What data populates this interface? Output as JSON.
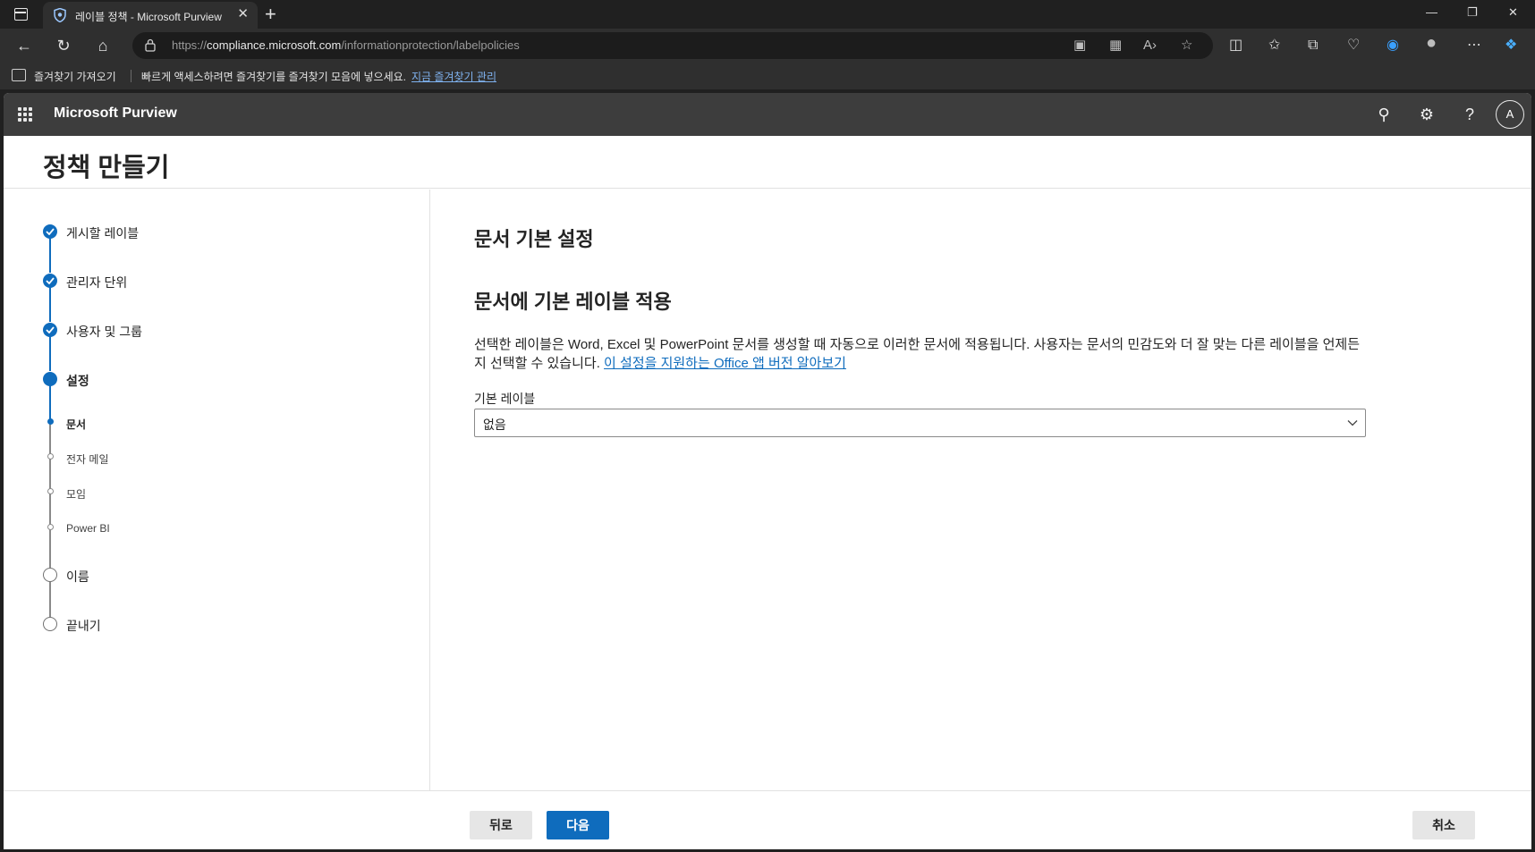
{
  "browser": {
    "tab_title": "레이블 정책 - Microsoft Purview",
    "tab_close": "✕",
    "new_tab": "+",
    "url_prefix": "https://",
    "url_host": "compliance.microsoft.com",
    "url_path": "/informationprotection/labelpolicies",
    "favorites": {
      "import_label": "즐겨찾기 가져오기",
      "message": "빠르게 액세스하려면 즐겨찾기를 즐겨찾기 모음에 넣으세요.",
      "manage_link": "지금 즐겨찾기 관리"
    },
    "window_controls": {
      "minimize": "—",
      "restore": "❐",
      "close": "✕"
    }
  },
  "app": {
    "brand": "Microsoft Purview",
    "avatar_initial": "A",
    "help_glyph": "?"
  },
  "page": {
    "title": "정책 만들기"
  },
  "steps": [
    {
      "label": "게시할 레이블",
      "state": "done"
    },
    {
      "label": "관리자 단위",
      "state": "done"
    },
    {
      "label": "사용자 및 그룹",
      "state": "done"
    },
    {
      "label": "설정",
      "state": "current"
    },
    {
      "label": "이름",
      "state": "todo"
    },
    {
      "label": "끝내기",
      "state": "todo"
    }
  ],
  "substeps": [
    {
      "label": "문서",
      "state": "current"
    },
    {
      "label": "전자 메일",
      "state": "todo"
    },
    {
      "label": "모임",
      "state": "todo"
    },
    {
      "label": "Power BI",
      "state": "todo"
    }
  ],
  "main": {
    "section_title": "문서 기본 설정",
    "sub_title": "문서에 기본 레이블 적용",
    "description": "선택한 레이블은 Word, Excel 및 PowerPoint 문서를 생성할 때 자동으로 이러한 문서에 적용됩니다. 사용자는 문서의 민감도와 더 잘 맞는 다른 레이블을 언제든지 선택할 수 있습니다. ",
    "learn_link": "이 설정을 지원하는 Office 앱 버전 알아보기",
    "field_label": "기본 레이블",
    "select_value": "없음"
  },
  "footer": {
    "back": "뒤로",
    "next": "다음",
    "cancel": "취소"
  },
  "colors": {
    "accent": "#0f6cbd",
    "appbar": "#3d3d3d",
    "browser_chrome": "#2f2f2f"
  }
}
